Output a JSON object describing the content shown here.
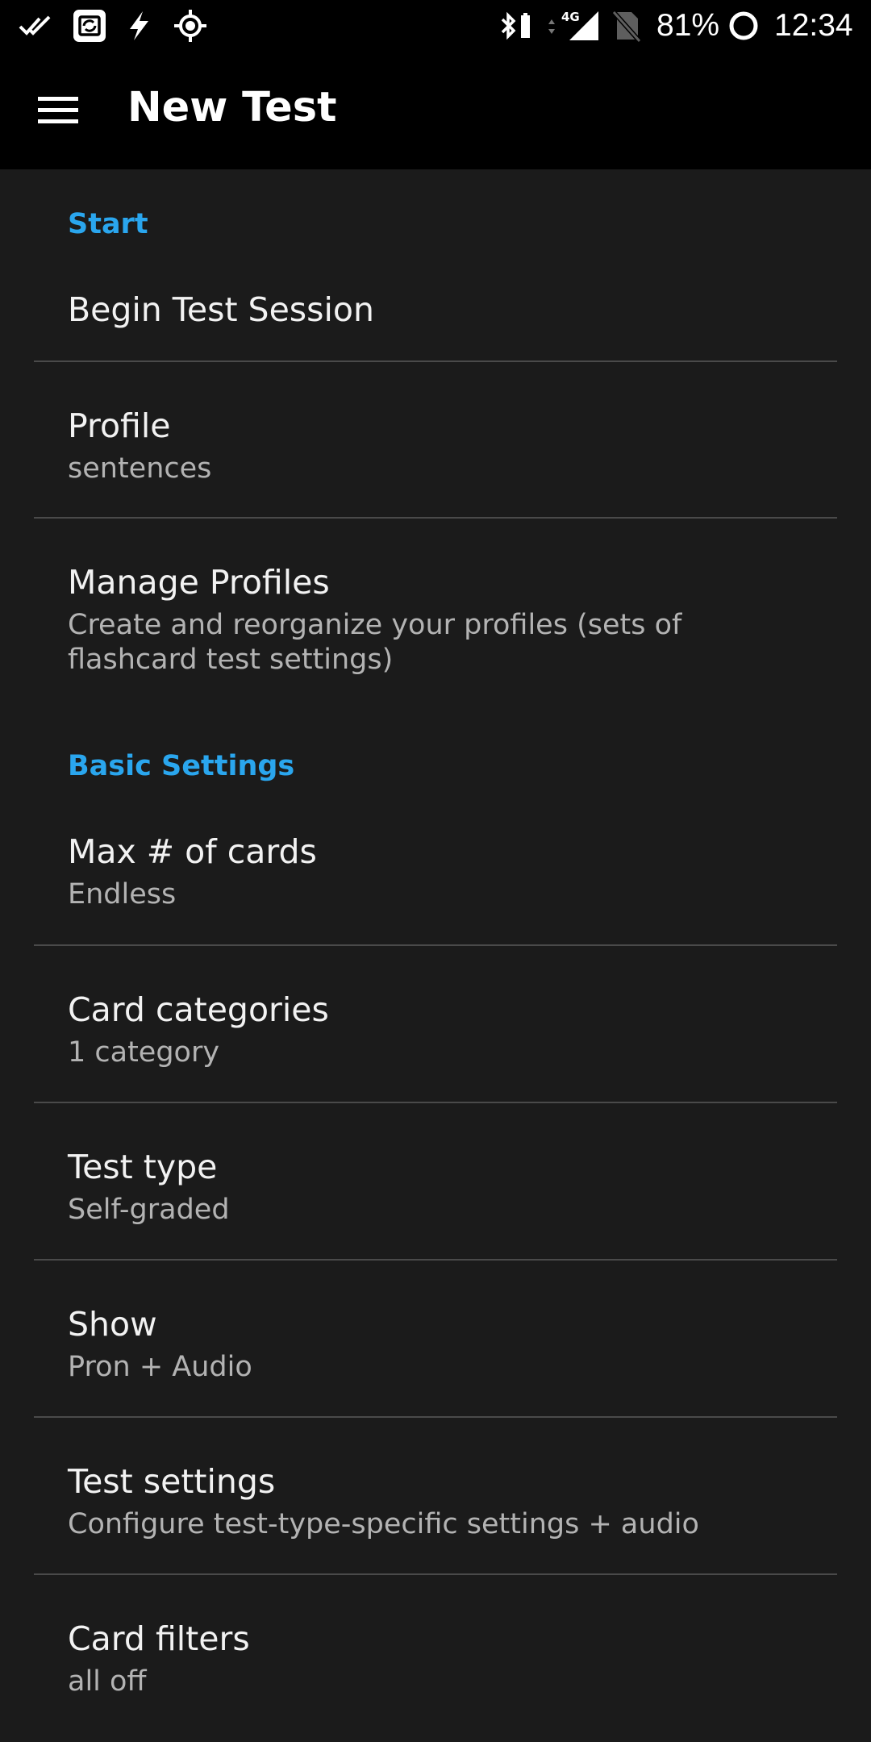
{
  "status_bar": {
    "battery_percent": "81%",
    "time": "12:34",
    "network": "4G",
    "icons": [
      "double-check-icon",
      "screen-record-icon",
      "flash-icon",
      "gps-icon",
      "bluetooth-icon",
      "signal-icon",
      "no-sim-icon",
      "battery-ring-icon"
    ]
  },
  "app_bar": {
    "title": "New Test",
    "menu_icon": "hamburger-menu-icon"
  },
  "sections": {
    "start": {
      "header": "Start",
      "begin": {
        "title": "Begin Test Session"
      },
      "profile": {
        "title": "Profile",
        "summary": "sentences"
      },
      "manage_profiles": {
        "title": "Manage Profiles",
        "summary": "Create and reorganize your profiles (sets of flashcard test settings)"
      }
    },
    "basic": {
      "header": "Basic Settings",
      "max_cards": {
        "title": "Max # of cards",
        "summary": "Endless"
      },
      "categories": {
        "title": "Card categories",
        "summary": "1 category"
      },
      "test_type": {
        "title": "Test type",
        "summary": "Self-graded"
      },
      "show": {
        "title": "Show",
        "summary": "Pron + Audio"
      },
      "test_settings": {
        "title": "Test settings",
        "summary": "Configure test-type-specific settings + audio"
      },
      "filters": {
        "title": "Card filters",
        "summary": "all off"
      }
    }
  },
  "colors": {
    "background": "#1b1b1b",
    "bar": "#000000",
    "accent": "#2aa6ee",
    "divider": "#4a4a4a",
    "summary_text": "#b3b3b3"
  }
}
